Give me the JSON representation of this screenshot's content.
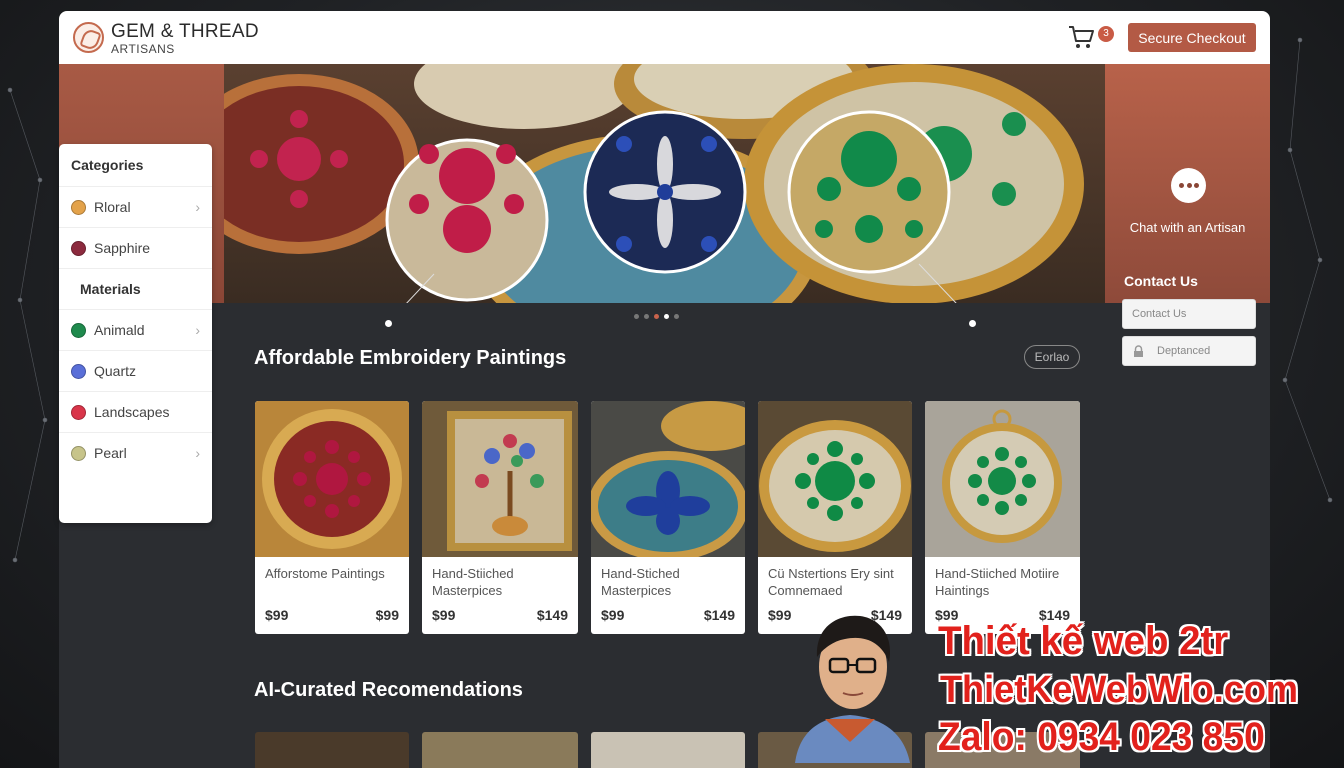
{
  "header": {
    "brand_name": "GEM & THREAD",
    "brand_sub": "ARTISANS",
    "cart_count": "3",
    "checkout_label": "Secure Checkout"
  },
  "hero": {
    "chat_label": "Chat with an Artisan",
    "contact_title": "Contact Us",
    "contact_input_placeholder": "Contact Us",
    "secondary_input_placeholder": "Deptanced",
    "carousel_count": 5,
    "carousel_active": 3
  },
  "sidebar": {
    "categories_title": "Categories",
    "category_items": [
      {
        "label": "Rloral",
        "color": "#e3a24a",
        "has_chevron": true
      },
      {
        "label": "Sapphire",
        "color": "#8c2a3e",
        "has_chevron": false
      }
    ],
    "materials_title": "Materials",
    "material_items": [
      {
        "label": "Animald",
        "color": "#1f8a4d",
        "has_chevron": true
      },
      {
        "label": "Quartz",
        "color": "#5a6fd8",
        "has_chevron": false
      },
      {
        "label": "Landscapes",
        "color": "#d9354a",
        "has_chevron": false
      },
      {
        "label": "Pearl",
        "color": "#c7c48a",
        "has_chevron": true
      }
    ]
  },
  "section1": {
    "title": "Affordable Embroidery Paintings",
    "explore_label": "Eorlao",
    "cards": [
      {
        "name": "Afforstome Paintings",
        "price_a": "$99",
        "price_b": "$99",
        "theme": "ruby"
      },
      {
        "name": "Hand-Stiiched Masterpices",
        "price_a": "$99",
        "price_b": "$149",
        "theme": "tree"
      },
      {
        "name": "Hand-Stiched Masterpices",
        "price_a": "$99",
        "price_b": "$149",
        "theme": "sapphire"
      },
      {
        "name": "Cü Nstertions Ery sint Comnemaed",
        "price_a": "$99",
        "price_b": "$149",
        "theme": "emerald"
      },
      {
        "name": "Hand-Stiiched Motiire Haintings",
        "price_a": "$99",
        "price_b": "$149",
        "theme": "emerald-hoop"
      }
    ]
  },
  "section2": {
    "title": "AI-Curated Recomendations"
  },
  "promo": {
    "line1": "Thiết kế web 2tr",
    "line2": "ThietKeWebWio.com",
    "line3": "Zalo: 0934 023 850"
  },
  "colors": {
    "accent": "#b35a45",
    "promo_red": "#e2211c"
  }
}
